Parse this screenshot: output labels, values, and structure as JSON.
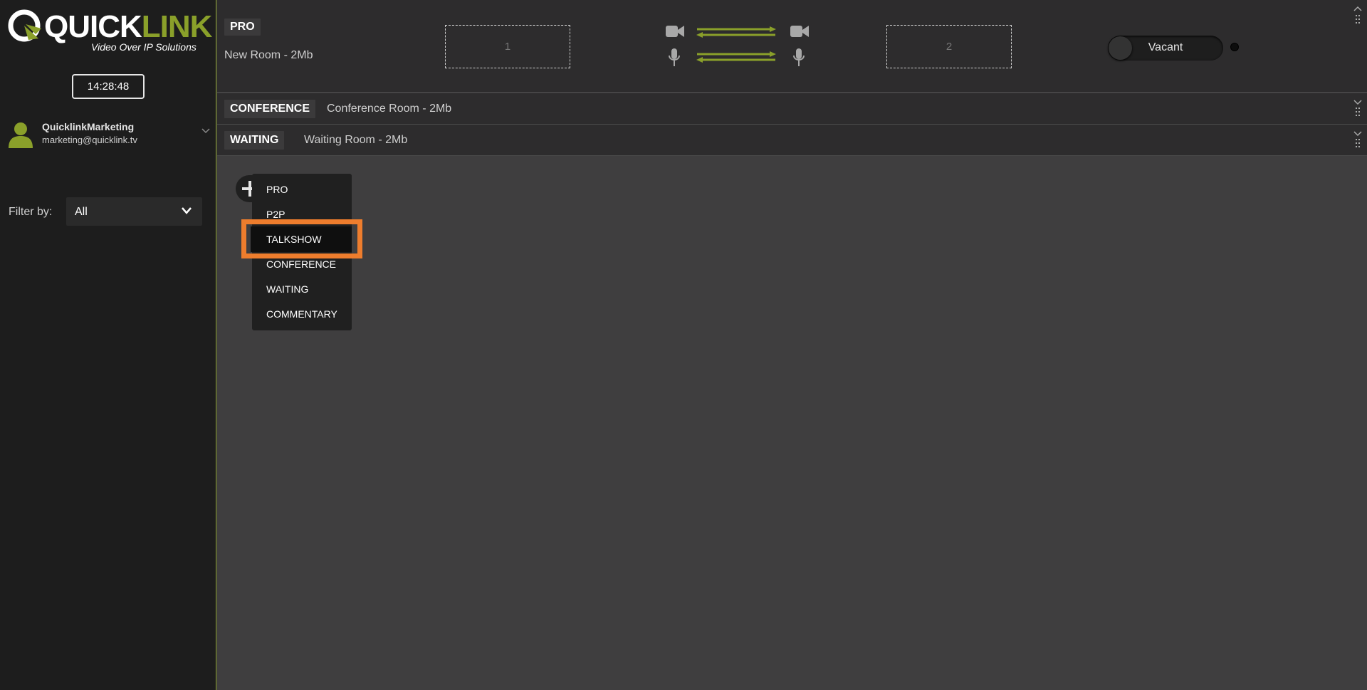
{
  "brand": {
    "logo_quick": "QUICK",
    "logo_link": "LINK",
    "tagline": "Video Over IP Solutions",
    "accent_color": "#8aa02a"
  },
  "sidebar": {
    "clock": "14:28:48",
    "user": {
      "name": "QuicklinkMarketing",
      "email": "marketing@quicklink.tv"
    },
    "filter": {
      "label": "Filter by:",
      "value": "All"
    }
  },
  "rooms": {
    "pro": {
      "type": "PRO",
      "name": "New Room - 2Mb",
      "slot1": "1",
      "slot2": "2",
      "status": "Vacant"
    },
    "conference": {
      "type": "CONFERENCE",
      "name": "Conference Room - 2Mb"
    },
    "waiting": {
      "type": "WAITING",
      "name": "Waiting Room - 2Mb"
    }
  },
  "add_menu": {
    "items": [
      "PRO",
      "P2P",
      "TALKSHOW",
      "CONFERENCE",
      "WAITING",
      "COMMENTARY"
    ],
    "highlighted": "TALKSHOW",
    "highlight_color": "#ee7d2d"
  }
}
